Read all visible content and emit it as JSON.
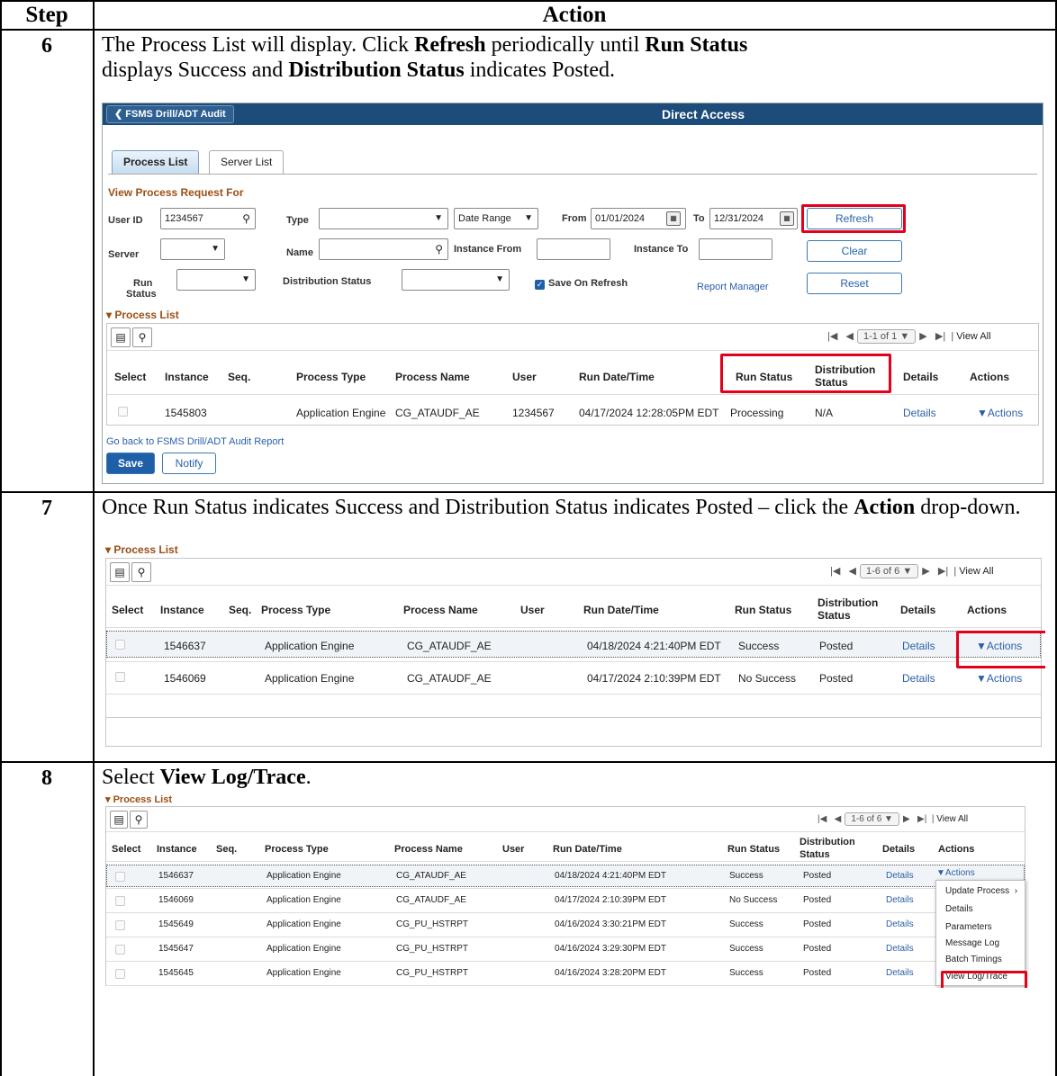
{
  "table": {
    "header_step": "Step",
    "header_action": "Action"
  },
  "steps": [
    {
      "num": "6",
      "text_parts": [
        "The Process List will display. Click ",
        "Refresh",
        " periodically until ",
        "Run Status",
        " displays Success and ",
        "Distribution Status",
        " indicates Posted."
      ],
      "screen": {
        "back_label": "FSMS Drill/ADT Audit",
        "title": "Direct Access",
        "tabs": [
          "Process List",
          "Server List"
        ],
        "section": "View Process Request For",
        "user_id_label": "User ID",
        "user_id": "1234567",
        "type_label": "Type",
        "date_range": "Date Range",
        "from_label": "From",
        "from_date": "01/01/2024",
        "to_label": "To",
        "to_date": "12/31/2024",
        "server_label": "Server",
        "name_label": "Name",
        "instance_from_label": "Instance From",
        "instance_to_label": "Instance To",
        "run_status_label_1": "Run",
        "run_status_label_2": "Status",
        "distribution_status_label": "Distribution Status",
        "save_on_refresh": "Save On Refresh",
        "report_manager": "Report Manager",
        "refresh": "Refresh",
        "clear": "Clear",
        "reset": "Reset",
        "process_list": "Process List",
        "pager": "1-1 of 1",
        "view_all": "View All",
        "columns": [
          "Select",
          "Instance",
          "Seq.",
          "Process Type",
          "Process Name",
          "User",
          "Run Date/Time",
          "Run Status",
          "Distribution Status",
          "Details",
          "Actions"
        ],
        "row": {
          "instance": "1545803",
          "type": "Application Engine",
          "name": "CG_ATAUDF_AE",
          "user": "1234567",
          "datetime": "04/17/2024 12:28:05PM EDT",
          "run_status": "Processing",
          "dist": "N/A",
          "details": "Details",
          "actions": "Actions"
        },
        "go_back": "Go back to FSMS Drill/ADT Audit Report",
        "save": "Save",
        "notify": "Notify"
      }
    },
    {
      "num": "7",
      "text_parts": [
        "Once Run Status indicates Success and Distribution Status indicates Posted – click the ",
        "Action",
        " drop-down."
      ],
      "screen": {
        "process_list": "Process List",
        "pager": "1-6 of 6",
        "view_all": "View All",
        "rows": [
          {
            "instance": "1546637",
            "type": "Application Engine",
            "name": "CG_ATAUDF_AE",
            "datetime": "04/18/2024  4:21:40PM EDT",
            "run_status": "Success",
            "dist": "Posted",
            "details": "Details",
            "actions": "Actions"
          },
          {
            "instance": "1546069",
            "type": "Application Engine",
            "name": "CG_ATAUDF_AE",
            "datetime": "04/17/2024  2:10:39PM EDT",
            "run_status": "No Success",
            "dist": "Posted",
            "details": "Details",
            "actions": "Actions"
          }
        ]
      }
    },
    {
      "num": "8",
      "text_parts": [
        "Select ",
        "View Log/Trace",
        "."
      ],
      "screen": {
        "process_list": "Process List",
        "pager": "1-6 of 6",
        "view_all": "View All",
        "rows": [
          {
            "instance": "1546637",
            "type": "Application Engine",
            "name": "CG_ATAUDF_AE",
            "datetime": "04/18/2024  4:21:40PM EDT",
            "run_status": "Success",
            "dist": "Posted",
            "details": "Details"
          },
          {
            "instance": "1546069",
            "type": "Application Engine",
            "name": "CG_ATAUDF_AE",
            "datetime": "04/17/2024  2:10:39PM EDT",
            "run_status": "No Success",
            "dist": "Posted",
            "details": "Details"
          },
          {
            "instance": "1545649",
            "type": "Application Engine",
            "name": "CG_PU_HSTRPT",
            "datetime": "04/16/2024  3:30:21PM EDT",
            "run_status": "Success",
            "dist": "Posted",
            "details": "Details"
          },
          {
            "instance": "1545647",
            "type": "Application Engine",
            "name": "CG_PU_HSTRPT",
            "datetime": "04/16/2024  3:29:30PM EDT",
            "run_status": "Success",
            "dist": "Posted",
            "details": "Details"
          },
          {
            "instance": "1545645",
            "type": "Application Engine",
            "name": "CG_PU_HSTRPT",
            "datetime": "04/16/2024  3:28:20PM EDT",
            "run_status": "Success",
            "dist": "Posted",
            "details": "Details"
          }
        ],
        "menu": [
          "Update Process",
          "Details",
          "Parameters",
          "Message Log",
          "Batch Timings",
          "View Log/Trace"
        ]
      }
    }
  ]
}
